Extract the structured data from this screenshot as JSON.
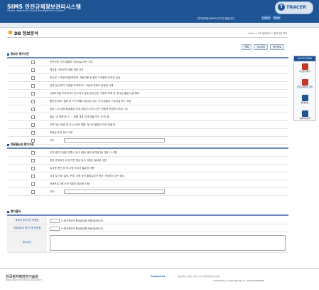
{
  "header": {
    "logo_main": "SIMS 안전규제정보관리시스템",
    "logo_sub": "Safety regulatory Issues Management System",
    "user_info": "연구관리팀 (KINS) 로그인 중입니다.",
    "logout_label": "Logout",
    "home_label": "Home",
    "brand": "TRACER"
  },
  "page": {
    "title": "DB 정보분석",
    "breadcrumb": "Home > DB 정보분석 > 평가기준 목록"
  },
  "buttons": {
    "list": "목록",
    "save": "임시저장",
    "submit": "평가완료"
  },
  "sections": {
    "importance": {
      "title": "중요도 평가기준",
      "items": [
        "안전관련 기기/계통의 기능상실 또는 고장",
        "제거통 사건/인적 제한 제반 사건",
        "방사성, 1차냉각재압력경계, 격납건물 및 중요 구조물의 건전성 상실",
        "설계 및 인허가 기준을 초과하거나 기술적 문제가 발생한 사례",
        "규제요건을 초과하거나 준수하지 않음 방사선량, 작업자 피폭 등 방사성 물질 누설 확대",
        "불안정 정도/ 설비 및 기기 역할 가능성이 있는 기기/계통의 기능상실 또는 고장",
        "공장 시고 공장 회로들과 관계 (특성 다시의 시간 (안정적 운영의 미치는 것)",
        "회로, 내 방향 중 수 ㆍ 위험 계통 (안전계통 모드 요구) 등",
        "안전기능 (방호 및 감시) 관련 결함, 방사선 물질의 과잉 방출 등",
        "비정상 운전 등의 고장"
      ],
      "etc_label": "기타"
    },
    "applicability": {
      "title": "적용필요성 평가기준",
      "items": [
        "인지 중인 이상한 경향 ( 유사 공정/ 설비 유의점 등) 개정 시 사항",
        "현장 규제요건 소관/기준 현상 유사 개정이 필요한 사항",
        "유사한 원인 등 재 시험 조치가 필요한 사항",
        "국내 및 국외 설계, 운영, 시험 상의 불확실성이 증가 가능성이 있는 경우",
        "규제프로그램 소관 지침이 필요한 사항"
      ],
      "etc_label": "기타"
    },
    "judgement": {
      "title": "평가결과",
      "importance_label": "중요성 평가기준 판정점",
      "importance_note": "※ 평가결과의 평균점수를 자동계산합니다.",
      "applicability_label": "적용필요성 평가기준 판정점",
      "applicability_note": "※ 평가결과의 평균점수를 자동계산합니다.",
      "opinion_label": "평가의견"
    }
  },
  "right_sidebar": {
    "head": "QUICK MENU",
    "items": [
      {
        "label": "사건분석평가",
        "icon": "document-icon",
        "color": "#c0392b"
      },
      {
        "label": "안전규제정보 관리",
        "icon": "monitor-icon",
        "color": "#c0392b"
      },
      {
        "label": "통계정보",
        "icon": "search-icon",
        "color": "#1f5595"
      },
      {
        "label": "사용자매뉴얼",
        "icon": "book-icon",
        "color": "#1f5595"
      }
    ]
  },
  "footer": {
    "logo": "한국원자력안전기술원",
    "logo_sub": "KOREA INSTITUTE OF NUCLEAR SAFETY",
    "contact": "Contact Us",
    "address": "대전광역시 유성구 과학로 62 한국원자력안전기술원",
    "copyright": "COPYRIGHT (C) 2009 TRACER. ALL RIGHTS RESERVED."
  },
  "colors": {
    "brand": "#1f5595",
    "accent": "#f3a51d"
  }
}
